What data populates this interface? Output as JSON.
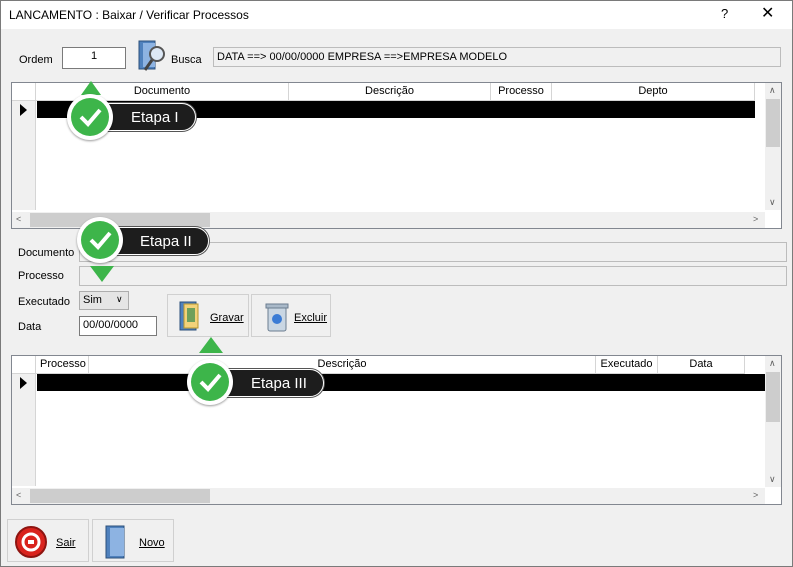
{
  "window": {
    "title": "LANCAMENTO : Baixar / Verificar Processos",
    "help": "?",
    "close": "✕"
  },
  "top": {
    "ordem_label": "Ordem",
    "ordem_value": "1",
    "busca_label": "Busca",
    "info_text": "DATA ==> 00/00/0000  EMPRESA ==>EMPRESA MODELO"
  },
  "grid1": {
    "columns": [
      "Documento",
      "Descrição",
      "Processo",
      "Depto"
    ]
  },
  "form": {
    "documento_label": "Documento",
    "processo_label": "Processo",
    "executado_label": "Executado",
    "executado_value": "Sim",
    "data_label": "Data",
    "data_value": "00/00/0000",
    "gravar_label": "Gravar",
    "excluir_label": "Excluir"
  },
  "grid2": {
    "columns": [
      "Processo",
      "Descrição",
      "Executado",
      "Data"
    ]
  },
  "bottom": {
    "sair_label": "Sair",
    "novo_label": "Novo"
  },
  "callouts": {
    "etapa1": "Etapa I",
    "etapa2": "Etapa II",
    "etapa3": "Etapa III"
  },
  "colors": {
    "callout_bg": "#1d1d1d",
    "check_green": "#3db54a",
    "selected_row": "#000000"
  }
}
